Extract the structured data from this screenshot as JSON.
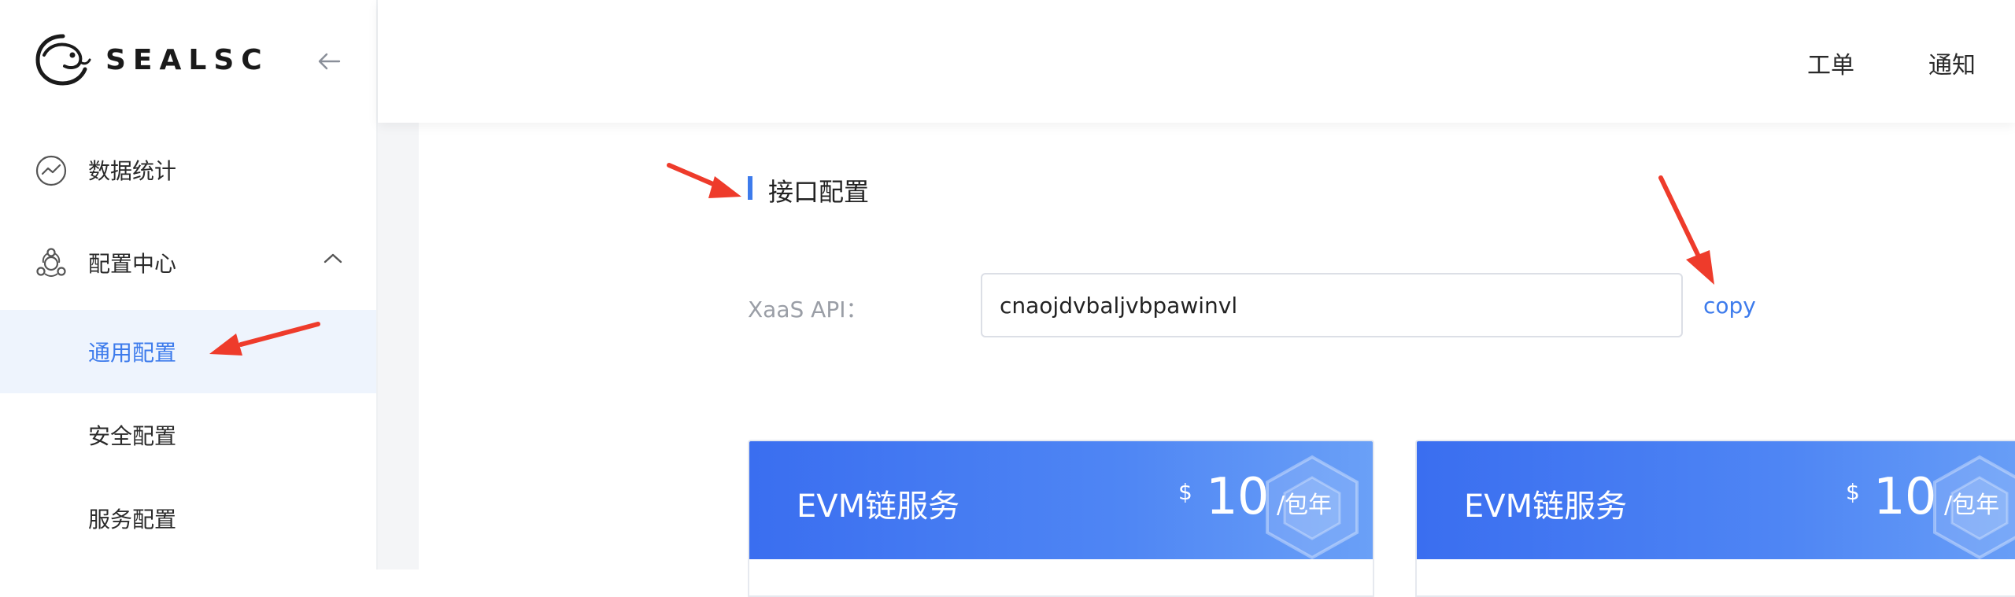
{
  "brand": {
    "name": "SEALSC"
  },
  "sidebar": {
    "items": [
      {
        "label": "数据统计",
        "icon": "chart-trend-icon"
      },
      {
        "label": "配置中心",
        "icon": "config-cluster-icon",
        "expanded": true
      }
    ],
    "sub_items": [
      {
        "label": "通用配置",
        "active": true
      },
      {
        "label": "安全配置",
        "active": false
      },
      {
        "label": "服务配置",
        "active": false
      }
    ]
  },
  "header": {
    "links": [
      {
        "label": "工单"
      },
      {
        "label": "通知"
      }
    ]
  },
  "main": {
    "section_title": "接口配置",
    "api": {
      "label": "XaaS API：",
      "value": "cnaojdvbaljvbpawinvl",
      "copy_label": "copy"
    },
    "cards": [
      {
        "title": "EVM链服务",
        "currency": "$",
        "price": "10",
        "unit": "/包年"
      },
      {
        "title": "EVM链服务",
        "currency": "$",
        "price": "10",
        "unit": "/包年"
      }
    ]
  },
  "colors": {
    "accent": "#3d7bec",
    "active_bg": "#eef4fd",
    "card_gradient_start": "#3a6ef0",
    "card_gradient_end": "#6aa0f7",
    "annotation_arrow": "#ee3b2b"
  }
}
